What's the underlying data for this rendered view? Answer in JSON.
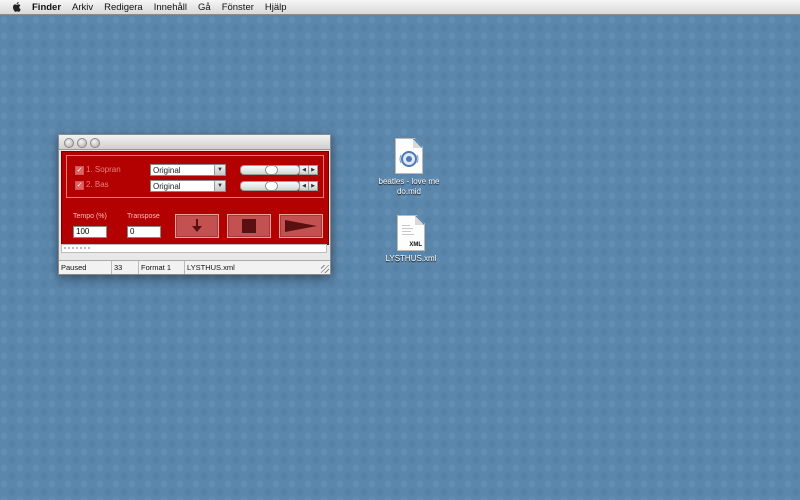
{
  "menubar": {
    "app": "Finder",
    "items": [
      "Arkiv",
      "Redigera",
      "Innehåll",
      "Gå",
      "Fönster",
      "Hjälp"
    ]
  },
  "window": {
    "tracks": [
      {
        "label": "1. Sopran",
        "instrument": "Original"
      },
      {
        "label": "2. Bas",
        "instrument": "Original"
      }
    ],
    "tempo_label": "Tempo (%)",
    "tempo_value": "100",
    "transpose_label": "Transpose",
    "transpose_value": "0",
    "buttons": {
      "down": "down-arrow-icon",
      "stop": "stop-icon",
      "play": "play-icon"
    },
    "status": {
      "state": "Paused",
      "number": "33",
      "format": "Format 1",
      "file": "LYSTHUS.xml"
    }
  },
  "desktop": {
    "icons": [
      {
        "label": "beatles - love me do.mid",
        "type": "midi-file-icon"
      },
      {
        "label": "LYSTHUS.xml",
        "type": "xml-file-icon",
        "badge": "XML"
      }
    ]
  },
  "colors": {
    "desktop": "#5b87ad",
    "panel": "#b30000",
    "button": "#c45151"
  }
}
